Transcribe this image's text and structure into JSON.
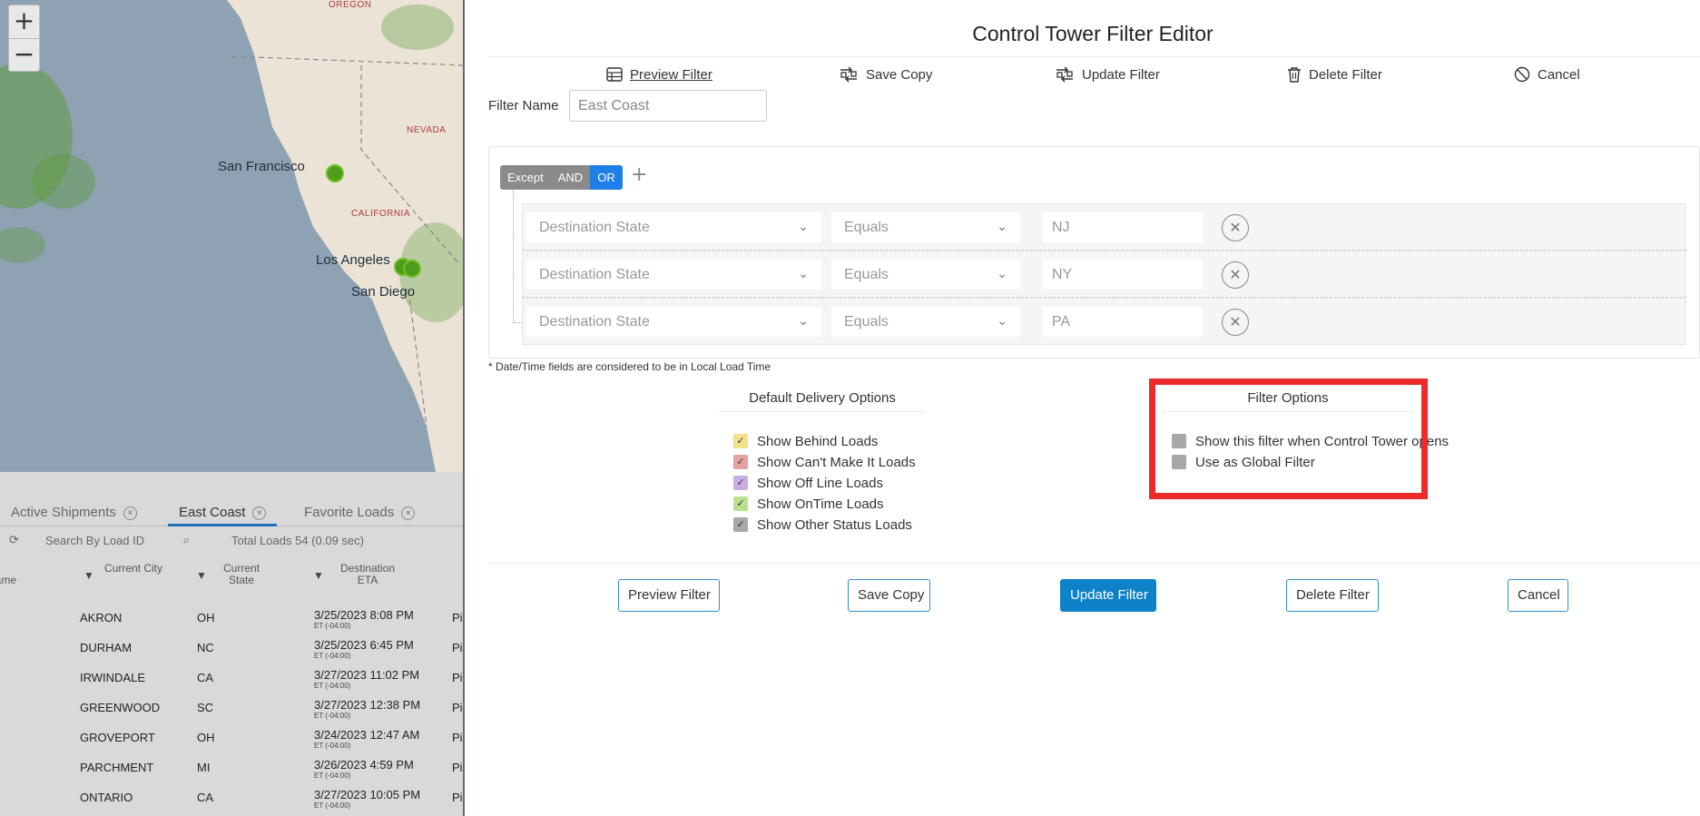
{
  "map": {
    "zoom_in": "+",
    "zoom_out": "−",
    "state_labels": [
      "OREGON",
      "NEVADA",
      "CALIFORNIA"
    ],
    "city_labels": [
      "San Francisco",
      "Los Angeles",
      "San Diego"
    ]
  },
  "grid": {
    "tabs": [
      {
        "label": "Active Shipments",
        "close": "×"
      },
      {
        "label": "East Coast",
        "close": "×"
      },
      {
        "label": "Favorite Loads",
        "close": "×"
      }
    ],
    "search_placeholder": "Search By Load ID",
    "total": "Total Loads 54 (0.09 sec)",
    "columns": [
      {
        "label": "Name"
      },
      {
        "label": "Current City"
      },
      {
        "label": "Current State"
      },
      {
        "label": "Destination ETA"
      }
    ],
    "rows": [
      {
        "city": "AKRON",
        "state": "OH",
        "eta": "3/25/2023  8:08 PM",
        "tz": "ET (-04:00)",
        "next": "Pi"
      },
      {
        "city": "DURHAM",
        "state": "NC",
        "eta": "3/25/2023  6:45 PM",
        "tz": "ET (-04:00)",
        "next": "Pi"
      },
      {
        "city": "IRWINDALE",
        "state": "CA",
        "eta": "3/27/2023  11:02 PM",
        "tz": "ET (-04:00)",
        "next": "Pi"
      },
      {
        "city": "GREENWOOD",
        "state": "SC",
        "eta": "3/27/2023  12:38 PM",
        "tz": "ET (-04:00)",
        "next": "Pi"
      },
      {
        "city": "GROVEPORT",
        "state": "OH",
        "eta": "3/24/2023  12:47 AM",
        "tz": "ET (-04:00)",
        "next": "Pi"
      },
      {
        "city": "PARCHMENT",
        "state": "MI",
        "eta": "3/26/2023  4:59 PM",
        "tz": "ET (-04:00)",
        "next": "Pi"
      },
      {
        "city": "ONTARIO",
        "state": "CA",
        "eta": "3/27/2023  10:05 PM",
        "tz": "ET (-04:00)",
        "next": "Pi"
      }
    ]
  },
  "modal": {
    "title": "Control Tower Filter Editor",
    "toolbar": {
      "preview": "Preview Filter",
      "save_copy": "Save Copy",
      "update": "Update Filter",
      "delete": "Delete Filter",
      "cancel": "Cancel"
    },
    "filter_name_label": "Filter Name",
    "filter_name_value": "East Coast",
    "logic": {
      "except": "Except",
      "and": "AND",
      "or": "OR",
      "add": "+"
    },
    "rules": [
      {
        "field": "Destination State",
        "operator": "Equals",
        "value": "NJ"
      },
      {
        "field": "Destination State",
        "operator": "Equals",
        "value": "NY"
      },
      {
        "field": "Destination State",
        "operator": "Equals",
        "value": "PA"
      }
    ],
    "note": "* Date/Time fields are considered to be in Local Load Time",
    "delivery_options": {
      "title": "Default Delivery Options",
      "items": [
        {
          "label": "Show Behind Loads",
          "color": "#f3e18a"
        },
        {
          "label": "Show Can't Make It Loads",
          "color": "#e6a1a1"
        },
        {
          "label": "Show Off Line Loads",
          "color": "#c9aee6"
        },
        {
          "label": "Show OnTime Loads",
          "color": "#b7e08f"
        },
        {
          "label": "Show Other Status Loads",
          "color": "#a8a8a8"
        }
      ]
    },
    "filter_options": {
      "title": "Filter Options",
      "items": [
        {
          "label": "Show this filter when Control Tower opens"
        },
        {
          "label": "Use as Global Filter"
        }
      ]
    },
    "footer": {
      "preview": "Preview Filter",
      "save_copy": "Save Copy",
      "update": "Update Filter",
      "delete": "Delete Filter",
      "cancel": "Cancel"
    },
    "accent_color": "#0e82c9",
    "highlight_color": "#ee2b2b"
  }
}
